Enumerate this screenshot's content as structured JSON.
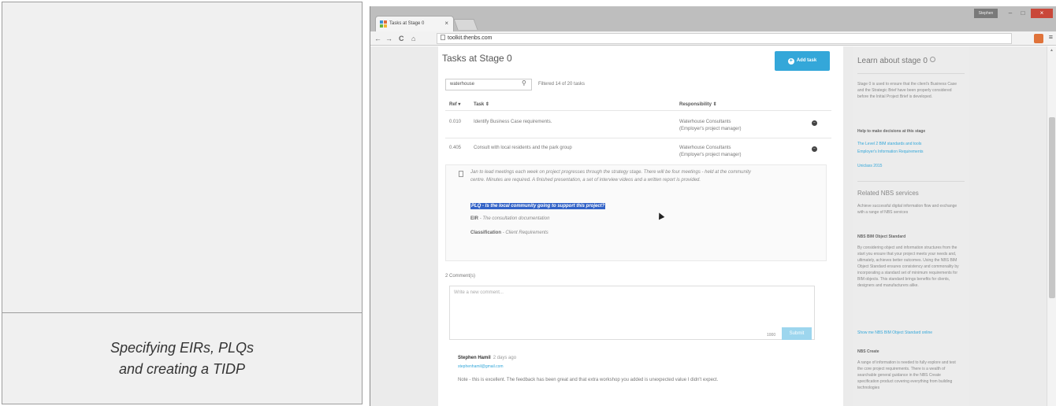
{
  "caption": {
    "line1": "Specifying EIRs, PLQs",
    "line2": "and creating a TIDP"
  },
  "browser": {
    "tab_title": "Tasks at Stage 0",
    "tab_close": "×",
    "user": "Stephen",
    "min": "–",
    "max": "□",
    "close": "×",
    "back": "←",
    "forward": "→",
    "reload": "C",
    "home": "⌂",
    "url": "toolkit.thenbs.com",
    "menu": "≡"
  },
  "page": {
    "title": "Tasks at Stage 0",
    "add_task": "Add task",
    "search_value": "waterhouse",
    "filter_text": "Filtered 14 of 20 tasks",
    "col_ref": "Ref ▾",
    "col_task": "Task ⇕",
    "col_responsibility": "Responsibility ⇕",
    "rows": [
      {
        "ref": "0.010",
        "task": "Identify Business Case requirements.",
        "resp1": "Waterhouse Consultants",
        "resp2": "(Employer's project manager)"
      },
      {
        "ref": "0.405",
        "task": "Consult with local residents and the park group",
        "resp1": "Waterhouse Consultants",
        "resp2": "(Employer's project manager)"
      }
    ],
    "detail": {
      "text": "Jan to lead meetings each week on project progresses through the strategy stage. There will be four meetings - held at the community centre. Minutes are required. A finished presentation, a set of interview videos and a written report is provided.",
      "plq": "PLQ - Is the local community going to support this project?",
      "eir_label": "EIR",
      "eir_text": "- The consultation documentation",
      "class_label": "Classification",
      "class_text": "- Client Requirements"
    },
    "comments_count": "2 Comment(s)",
    "comment_placeholder": "Write a new comment...",
    "char_count": "1000",
    "submit": "Submit",
    "commenter": "Stephen Hamil",
    "comment_time": "2 days ago",
    "commenter_email": "stephenhamil@gmail.com",
    "comment_text": "Note - this is excellent. The feedback has been great and that extra workshop you added is unexpected value I didn't expect."
  },
  "sidebar": {
    "title": "Learn about stage 0",
    "intro": "Stage 0 is used to ensure that the client's Business Case and the Strategic Brief have been properly considered before the Initial Project Brief is developed.",
    "help_head": "Help to make decisions at this stage",
    "links": [
      "The Level 2 BIM standards and tools",
      "Employer's Information Requirements",
      "Uniclass 2015"
    ],
    "related": "Related NBS services",
    "related_text": "Achieve successful digital information flow and exchange with a range of NBS services",
    "bim_head": "NBS BIM Object Standard",
    "bim_text": "By considering object and information structures from the start you ensure that your project meets your needs and, ultimately, achieves better outcomes. Using the NBS BIM Object Standard ensures consistency and commonality by incorporating a standard set of minimum requirements for BIM objects. This standard brings benefits for clients, designers and manufacturers alike.",
    "bim_link": "Show me NBS BIM Object Standard online",
    "create_head": "NBS Create",
    "create_text": "A range of information is needed to fully explore and test the core project requirements. There is a wealth of searchable general guidance in the NBS Create specification product covering everything from building technologies"
  }
}
